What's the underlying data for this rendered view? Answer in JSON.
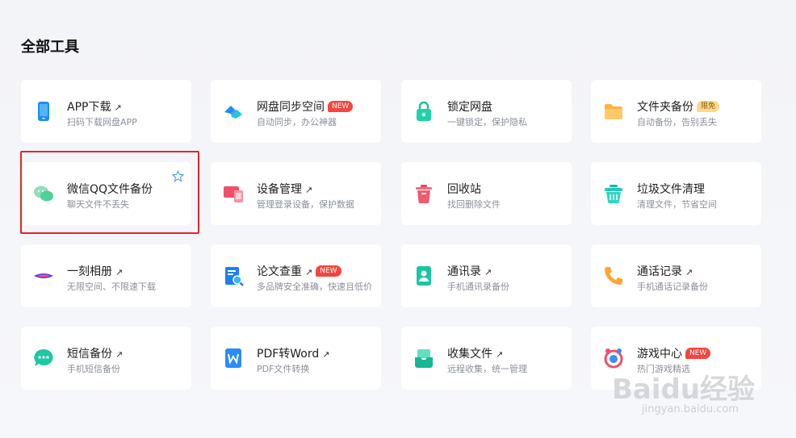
{
  "page": {
    "title": "全部工具"
  },
  "tools": [
    {
      "name": "APP下载",
      "desc": "扫码下载网盘APP",
      "arrow": "↗",
      "badge": "",
      "icon": "phone-icon"
    },
    {
      "name": "网盘同步空间",
      "desc": "自动同步，办公神器",
      "arrow": "",
      "badge": "NEW",
      "icon": "sync-icon"
    },
    {
      "name": "锁定网盘",
      "desc": "一键锁定，保护隐私",
      "arrow": "",
      "badge": "",
      "icon": "lock-icon"
    },
    {
      "name": "文件夹备份",
      "desc": "自动备份，告别丢失",
      "arrow": "",
      "badge": "限免",
      "icon": "folder-icon"
    },
    {
      "name": "微信QQ文件备份",
      "desc": "聊天文件不丢失",
      "arrow": "",
      "badge": "",
      "icon": "chat-bubbles-icon"
    },
    {
      "name": "设备管理",
      "desc": "管理登录设备，保护数据",
      "arrow": "↗",
      "badge": "",
      "icon": "devices-icon"
    },
    {
      "name": "回收站",
      "desc": "找回删除文件",
      "arrow": "",
      "badge": "",
      "icon": "trash-icon"
    },
    {
      "name": "垃圾文件清理",
      "desc": "清理文件，节省空间",
      "arrow": "",
      "badge": "",
      "icon": "basket-icon"
    },
    {
      "name": "一刻相册",
      "desc": "无限空间、不限速下载",
      "arrow": "↗",
      "badge": "",
      "icon": "album-icon"
    },
    {
      "name": "论文查重",
      "desc": "多品牌安全准确，快速且低价",
      "arrow": "↗",
      "badge": "NEW",
      "icon": "document-search-icon"
    },
    {
      "name": "通讯录",
      "desc": "手机通讯录备份",
      "arrow": "↗",
      "badge": "",
      "icon": "contacts-icon"
    },
    {
      "name": "通话记录",
      "desc": "手机通话记录备份",
      "arrow": "↗",
      "badge": "",
      "icon": "phone-call-icon"
    },
    {
      "name": "短信备份",
      "desc": "手机短信备份",
      "arrow": "↗",
      "badge": "",
      "icon": "message-icon"
    },
    {
      "name": "PDF转Word",
      "desc": "PDF文件转换",
      "arrow": "↗",
      "badge": "",
      "icon": "word-icon"
    },
    {
      "name": "收集文件",
      "desc": "远程收集，统一管理",
      "arrow": "↗",
      "badge": "",
      "icon": "inbox-icon"
    },
    {
      "name": "游戏中心",
      "desc": "热门游戏精选",
      "arrow": "",
      "badge": "NEW",
      "icon": "game-icon"
    }
  ],
  "watermark": {
    "brand": "Baidu经验",
    "url": "jingyan.baidu.com"
  }
}
